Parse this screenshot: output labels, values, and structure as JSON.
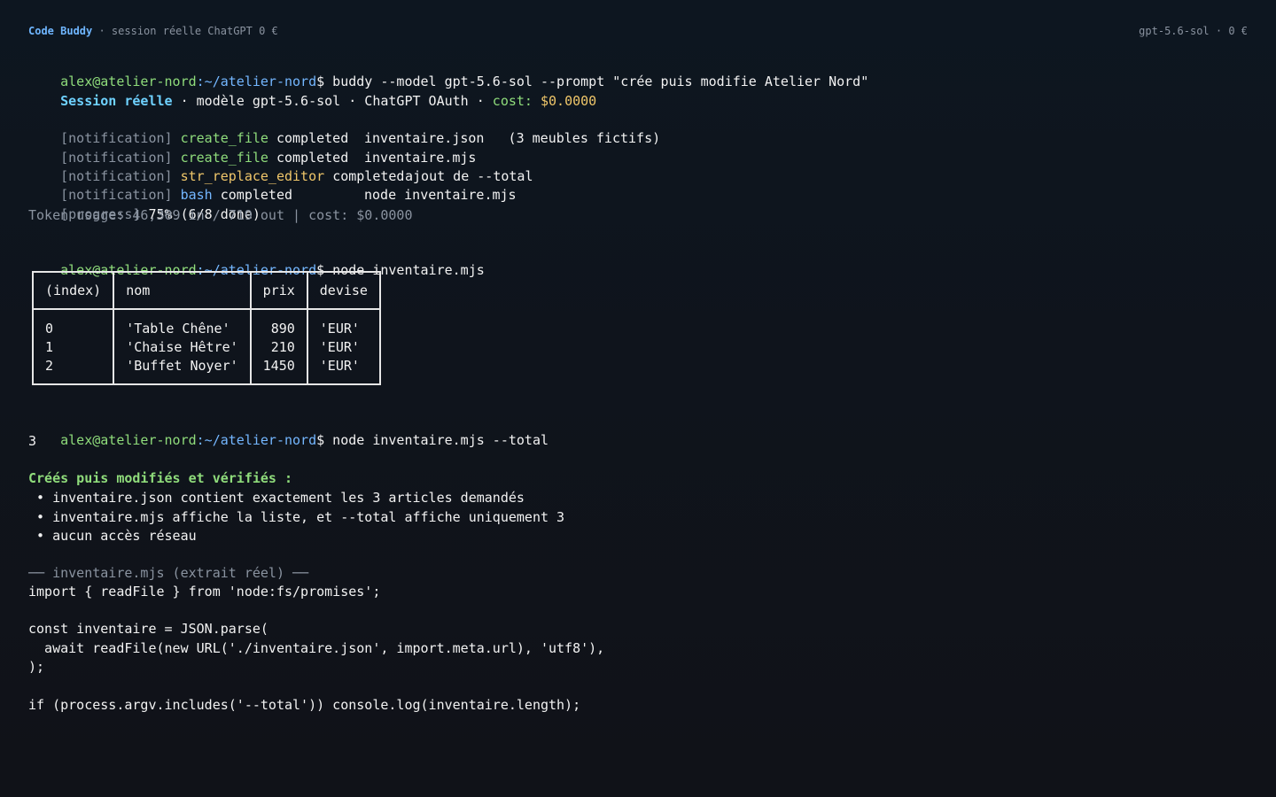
{
  "topbar": {
    "brand": "Code Buddy",
    "session": " · session réelle ChatGPT 0 €",
    "right": "gpt-5.6-sol · 0 €"
  },
  "cmd1": {
    "user": "alex@atelier-nord",
    "path": ":~/atelier-nord",
    "text": "$ buddy --model gpt-5.6-sol --prompt \"crée puis modifie Atelier Nord\""
  },
  "session": {
    "title": "Session réelle",
    "info": " · modèle gpt-5.6-sol · ChatGPT OAuth · ",
    "cost_label": "cost: ",
    "cost_value": "$0.0000"
  },
  "notifications": [
    {
      "tag": "[notification]",
      "tool": "create_file",
      "status": "completed",
      "target": "inventaire.json   (3 meubles fictifs)",
      "tool_color": "green"
    },
    {
      "tag": "[notification]",
      "tool": "create_file",
      "status": "completed",
      "target": "inventaire.mjs",
      "tool_color": "green"
    },
    {
      "tag": "[notification]",
      "tool": "str_replace_editor",
      "status": "completed",
      "target": "ajout de --total",
      "tool_color": "yellow"
    },
    {
      "tag": "[notification]",
      "tool": "bash",
      "status": "completed",
      "target": "node inventaire.mjs",
      "tool_color": "blue"
    }
  ],
  "progress": {
    "tag": "[progress]",
    "text": " 75% (6/8 done)"
  },
  "token_usage": "Token usage: 46,309 in / 719 out | cost: $0.0000",
  "cmd2": {
    "user": "alex@atelier-nord",
    "path": ":~/atelier-nord",
    "text": "$ node inventaire.mjs"
  },
  "table": {
    "headers": [
      "(index)",
      "nom",
      "prix",
      "devise"
    ],
    "rows": [
      [
        "0",
        "'Table Chêne'",
        "890",
        "'EUR'"
      ],
      [
        "1",
        "'Chaise Hêtre'",
        "210",
        "'EUR'"
      ],
      [
        "2",
        "'Buffet Noyer'",
        "1450",
        "'EUR'"
      ]
    ]
  },
  "cmd3": {
    "user": "alex@atelier-nord",
    "path": ":~/atelier-nord",
    "text": "$ node inventaire.mjs --total",
    "output": "3"
  },
  "summary": {
    "title": "Créés puis modifiés et vérifiés :",
    "bullets": [
      " • inventaire.json contient exactement les 3 articles demandés",
      " • inventaire.mjs affiche la liste, et --total affiche uniquement 3",
      " • aucun accès réseau"
    ]
  },
  "code_header": "── inventaire.mjs (extrait réel) ──",
  "code_lines": [
    "import { readFile } from 'node:fs/promises';",
    "",
    "const inventaire = JSON.parse(",
    "  await readFile(new URL('./inventaire.json', import.meta.url), 'utf8'),",
    ");",
    "",
    "if (process.argv.includes('--total')) console.log(inventaire.length);"
  ]
}
